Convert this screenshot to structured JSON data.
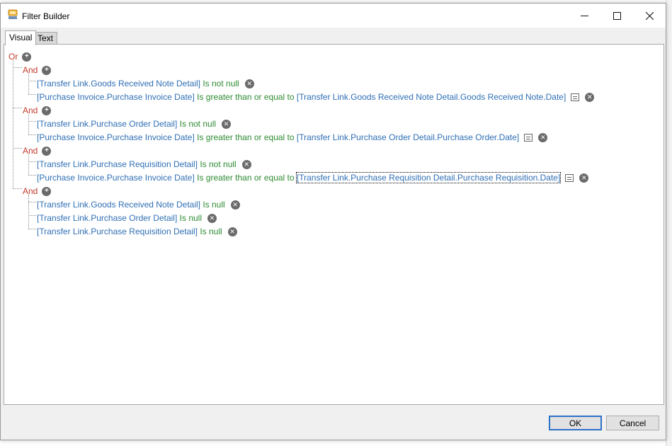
{
  "window": {
    "title": "Filter Builder",
    "controls": {
      "minimize": "—",
      "maximize": "☐",
      "close": "✕"
    }
  },
  "tabs": [
    {
      "label": "Visual",
      "active": true
    },
    {
      "label": "Text",
      "active": false
    }
  ],
  "tree": {
    "root": "Or",
    "groups": [
      {
        "label": "And",
        "conditions": [
          {
            "field": "[Transfer Link.Goods Received Note Detail]",
            "operator": "Is not null",
            "value": ""
          },
          {
            "field": "[Purchase Invoice.Purchase Invoice Date]",
            "operator": "Is greater than or equal to",
            "value": "[Transfer Link.Goods Received Note Detail.Goods Received Note.Date]"
          }
        ]
      },
      {
        "label": "And",
        "conditions": [
          {
            "field": "[Transfer Link.Purchase Order Detail]",
            "operator": "Is not null",
            "value": ""
          },
          {
            "field": "[Purchase Invoice.Purchase Invoice Date]",
            "operator": "Is greater than or equal to",
            "value": "[Transfer Link.Purchase Order Detail.Purchase Order.Date]"
          }
        ]
      },
      {
        "label": "And",
        "conditions": [
          {
            "field": "[Transfer Link.Purchase Requisition Detail]",
            "operator": "Is not null",
            "value": ""
          },
          {
            "field": "[Purchase Invoice.Purchase Invoice Date]",
            "operator": "Is greater than or equal to",
            "value": "[Transfer Link.Purchase Requisition Detail.Purchase Requisition.Date]"
          }
        ]
      },
      {
        "label": "And",
        "conditions": [
          {
            "field": "[Transfer Link.Goods Received Note Detail]",
            "operator": "Is null",
            "value": ""
          },
          {
            "field": "[Transfer Link.Purchase Order Detail]",
            "operator": "Is null",
            "value": ""
          },
          {
            "field": "[Transfer Link.Purchase Requisition Detail]",
            "operator": "Is null",
            "value": ""
          }
        ]
      }
    ]
  },
  "buttons": {
    "ok": "OK",
    "cancel": "Cancel"
  },
  "colors": {
    "group": "#c0392b",
    "field": "#2f6fb5",
    "operator": "#2e8b32",
    "accent": "#2d72c7"
  },
  "icons": {
    "add": "plus-circle-icon",
    "remove": "x-circle-icon",
    "edit": "value-editor-icon"
  }
}
